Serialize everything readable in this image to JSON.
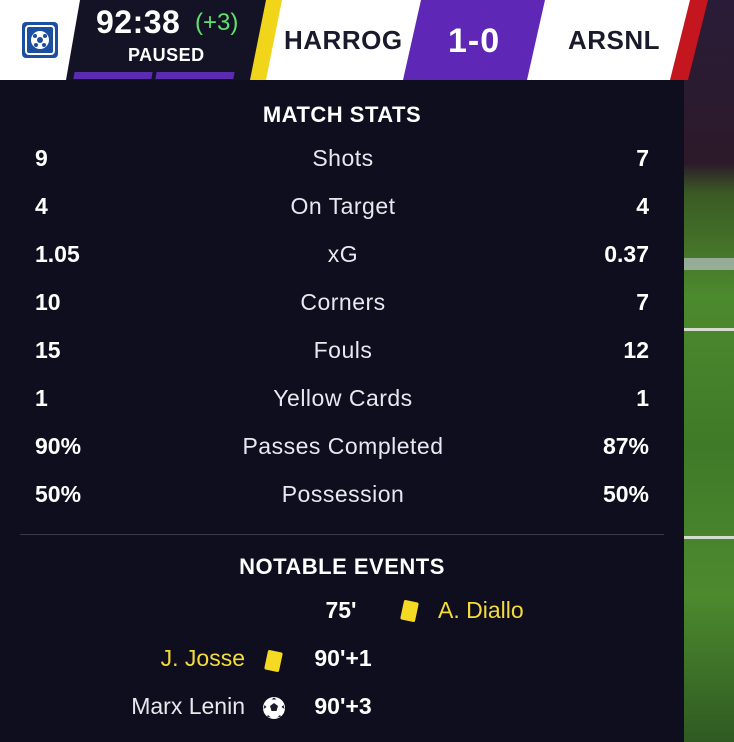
{
  "header": {
    "clock": "92:38",
    "added_time": "(+3)",
    "status": "PAUSED",
    "home_team": "HARROG",
    "score": "1-0",
    "away_team": "ARSNL"
  },
  "match_stats": {
    "title": "MATCH STATS",
    "rows": [
      {
        "label": "Shots",
        "home": "9",
        "away": "7"
      },
      {
        "label": "On Target",
        "home": "4",
        "away": "4"
      },
      {
        "label": "xG",
        "home": "1.05",
        "away": "0.37"
      },
      {
        "label": "Corners",
        "home": "10",
        "away": "7"
      },
      {
        "label": "Fouls",
        "home": "15",
        "away": "12"
      },
      {
        "label": "Yellow Cards",
        "home": "1",
        "away": "1"
      },
      {
        "label": "Passes Completed",
        "home": "90%",
        "away": "87%"
      },
      {
        "label": "Possession",
        "home": "50%",
        "away": "50%"
      }
    ]
  },
  "notable_events": {
    "title": "NOTABLE EVENTS",
    "items": [
      {
        "minute": "75'",
        "side": "away",
        "type": "yellow-card",
        "player": "A. Diallo"
      },
      {
        "minute": "90'+1",
        "side": "home",
        "type": "yellow-card",
        "player": "J. Josse"
      },
      {
        "minute": "90'+3",
        "side": "home",
        "type": "goal",
        "player": "Marx Lenin"
      }
    ]
  },
  "colors": {
    "home_accent": "#f0d51a",
    "away_accent": "#c4161e",
    "score_bg": "#5f27b6",
    "added_time": "#5fe06d",
    "yellow_card": "#f5d923"
  }
}
